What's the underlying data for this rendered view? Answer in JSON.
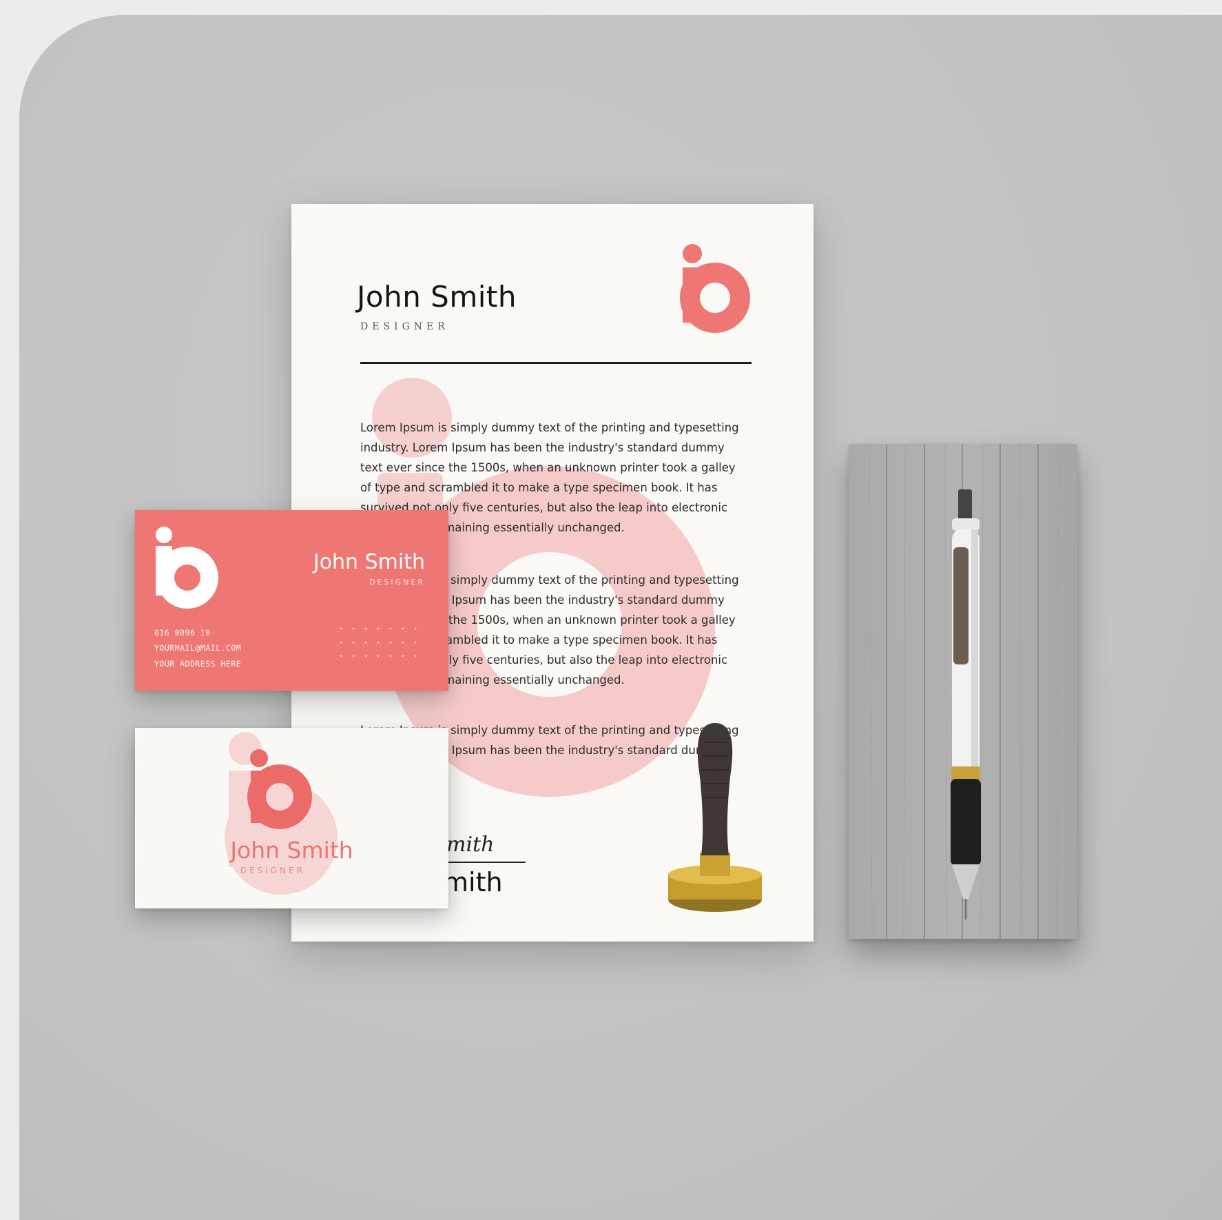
{
  "colors": {
    "brand_coral": "#ee7774",
    "watermark_pink": "#f5cccb",
    "paper": "#faf9f6",
    "background": "#c4c4c4",
    "ink": "#151515"
  },
  "letterhead": {
    "name": "John Smith",
    "role": "DESIGNER",
    "paragraph_1": "Lorem Ipsum is simply dummy text of the printing and typesetting industry. Lorem Ipsum has been the industry's standard dummy text ever since the 1500s, when an unknown printer took a galley of type and scrambled it to make a type specimen book. It has survived not only five centuries, but also the leap into electronic typesetting, remaining essentially unchanged.",
    "paragraph_2": "Lorem Ipsum is simply dummy text of the printing and typesetting industry. Lorem Ipsum has been the industry's standard dummy text ever since the 1500s, when an unknown printer took a galley of type and scrambled it to make a type specimen book. It has survived not only five centuries, but also the leap into electronic typesetting, remaining essentially unchanged.",
    "paragraph_3": "Lorem Ipsum is simply dummy text of the printing and typesetting industry. Lorem Ipsum has been the industry's standard dummy text",
    "signature": "mith",
    "signature_name": "mith"
  },
  "business_card_front": {
    "name": "John Smith",
    "role": "DESIGNER",
    "phone": "016 0096 10",
    "email": "YOURMAIL@MAIL.COM",
    "address": "YOUR ADDRESS HERE"
  },
  "business_card_back": {
    "name": "John Smith",
    "role": "DESIGNER"
  },
  "icons": [
    "brand-logo-icon",
    "rubber-stamp-icon",
    "pen-icon",
    "wooden-tray-icon"
  ]
}
